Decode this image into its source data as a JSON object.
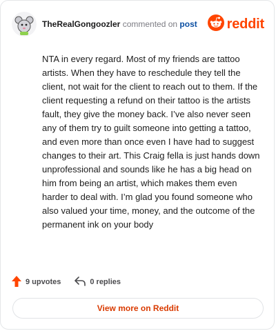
{
  "header": {
    "username": "TheRealGongoozler",
    "commented_label": "commented on",
    "post_link": "post",
    "brand": "reddit"
  },
  "comment": {
    "text": "NTA in every regard. Most of my friends are tattoo artists. When they have to reschedule they tell the client, not wait for the client to reach out to them. If the client requesting a refund on their tattoo is the artists fault, they give the money back. I’ve also never seen any of them try to guilt someone into getting a tattoo, and even more than once even I have had to suggest changes to their art. This Craig fella is just hands down unprofessional and sounds like he has a big head on him from being an artist, which makes them even harder to deal with. I’m glad you found someone who also valued your time, money, and the outcome of the permanent ink on your body"
  },
  "actions": {
    "upvotes": "9 upvotes",
    "replies": "0 replies"
  },
  "footer": {
    "view_more": "View more on Reddit"
  },
  "colors": {
    "brand": "#ff4500",
    "upvote": "#ff4500",
    "view_more": "#d93a00",
    "post_link": "#0b4fa2"
  },
  "icons": [
    "avatar",
    "reddit-logo-icon",
    "upvote-arrow-icon",
    "reply-icon"
  ]
}
